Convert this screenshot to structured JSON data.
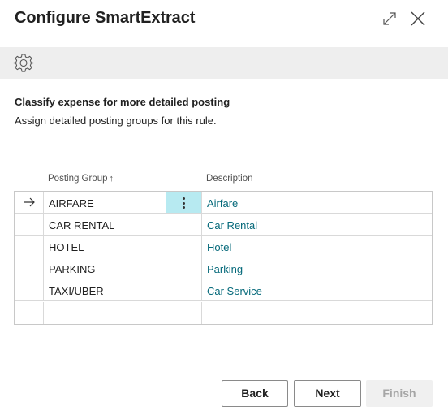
{
  "dialog": {
    "title": "Configure SmartExtract"
  },
  "toolbar": {
    "icons": [
      "expand-icon",
      "close-icon",
      "gear-icon"
    ]
  },
  "section": {
    "heading": "Classify expense for more detailed posting",
    "description": "Assign detailed posting groups for this rule."
  },
  "grid": {
    "columns": {
      "posting_group": "Posting Group",
      "sort_indicator": "↑",
      "description": "Description"
    },
    "rows": [
      {
        "posting_group": "AIRFARE",
        "description": "Airfare",
        "selected": true
      },
      {
        "posting_group": "CAR RENTAL",
        "description": "Car Rental",
        "selected": false
      },
      {
        "posting_group": "HOTEL",
        "description": "Hotel",
        "selected": false
      },
      {
        "posting_group": "PARKING",
        "description": "Parking",
        "selected": false
      },
      {
        "posting_group": "TAXI/UBER",
        "description": "Car Service",
        "selected": false
      },
      {
        "posting_group": "",
        "description": "",
        "selected": false
      }
    ]
  },
  "footer": {
    "back_label": "Back",
    "next_label": "Next",
    "finish_label": "Finish"
  },
  "colors": {
    "link": "#05697a",
    "selected_cell": "#b7eaf1",
    "action_bar": "#eeeeee",
    "disabled_button": "#f0f0f0"
  }
}
